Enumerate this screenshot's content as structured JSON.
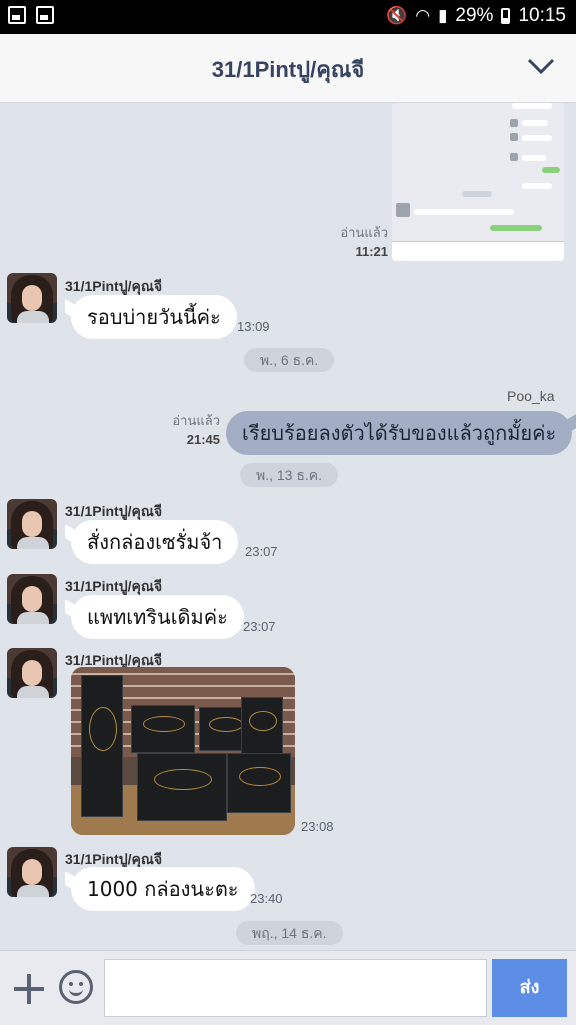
{
  "status_bar": {
    "battery": "29%",
    "time": "10:15"
  },
  "header": {
    "title": "31/1Pintปู/คุณจี"
  },
  "chat": {
    "read_label": "อ่านแล้ว",
    "preview_time": "11:21",
    "messages": [
      {
        "sender": "31/1Pintปู/คุณจี",
        "text": "รอบบ่ายวันนี้ค่ะ",
        "time": "13:09"
      },
      {
        "date": "พ., 6 ธ.ค."
      },
      {
        "sender": "Poo_ka",
        "text": "เรียบร้อยลงตัวได้รับของแล้วถูกมั้ยค่ะ",
        "time": "21:45",
        "read": "อ่านแล้ว"
      },
      {
        "date": "พ., 13 ธ.ค."
      },
      {
        "sender": "31/1Pintปู/คุณจี",
        "text": "สั่งกล่องเซรั่มจ้า",
        "time": "23:07"
      },
      {
        "sender": "31/1Pintปู/คุณจี",
        "text": "แพทเทรินเดิมค่ะ",
        "time": "23:07"
      },
      {
        "sender": "31/1Pintปู/คุณจี",
        "time": "23:08"
      },
      {
        "sender": "31/1Pintปู/คุณจี",
        "text": "1000 กล่องนะตะ",
        "time": "23:40"
      },
      {
        "date": "พฤ., 14 ธ.ค."
      }
    ]
  },
  "input_bar": {
    "send_label": "ส่ง",
    "placeholder": ""
  },
  "colors": {
    "chat_bg": "#dfe3ea",
    "outgoing_bubble": "#a3aec4",
    "send_button": "#5d8ee6"
  }
}
